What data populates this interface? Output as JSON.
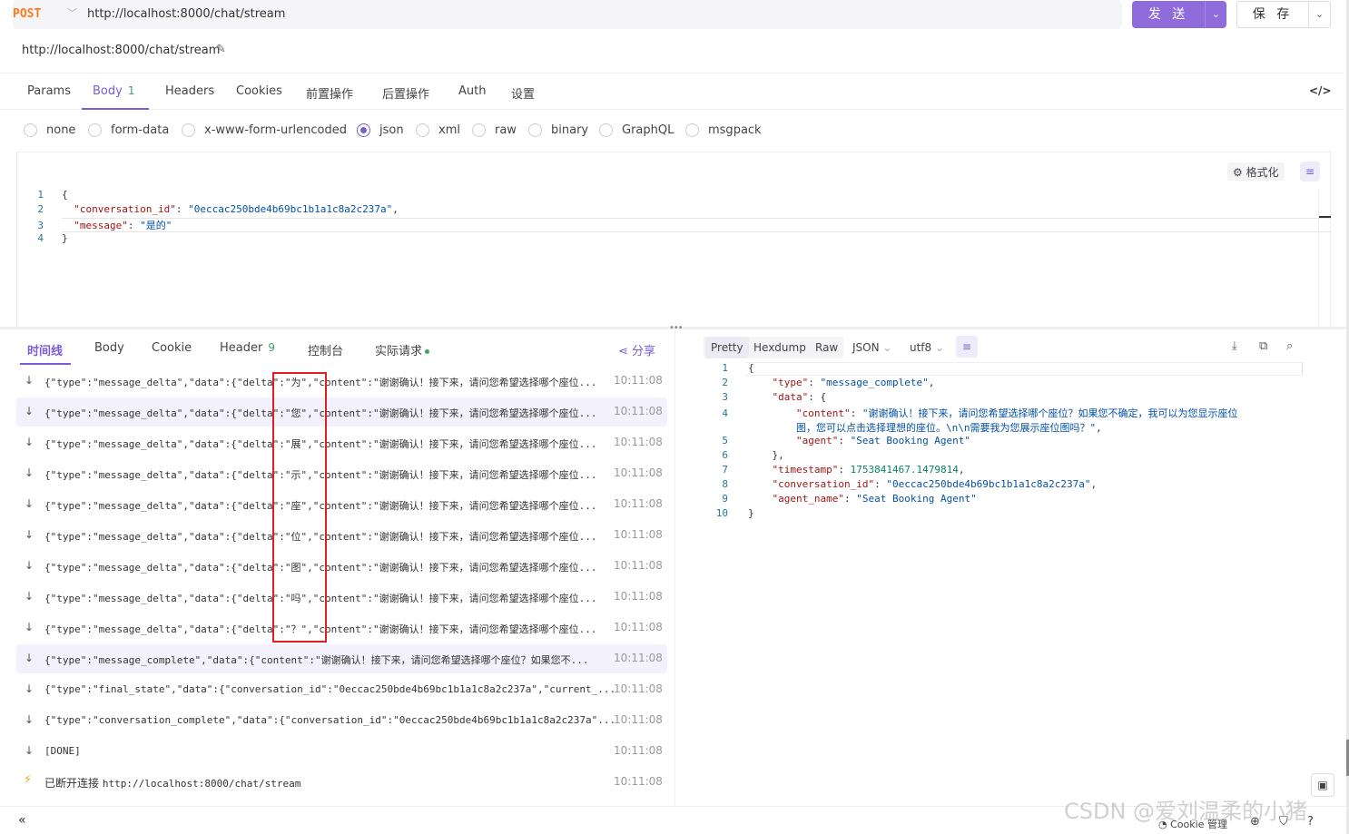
{
  "request": {
    "method": "POST",
    "url": "http://localhost:8000/chat/stream",
    "name": "http://localhost:8000/chat/stream",
    "send_label": "发 送",
    "save_label": "保 存"
  },
  "req_tabs": [
    {
      "label": "Params"
    },
    {
      "label": "Body",
      "count": "1"
    },
    {
      "label": "Headers"
    },
    {
      "label": "Cookies"
    },
    {
      "label": "前置操作"
    },
    {
      "label": "后置操作"
    },
    {
      "label": "Auth"
    },
    {
      "label": "设置"
    }
  ],
  "body_types": [
    "none",
    "form-data",
    "x-www-form-urlencoded",
    "json",
    "xml",
    "raw",
    "binary",
    "GraphQL",
    "msgpack"
  ],
  "body_type_selected": "json",
  "editor": {
    "format_label": "格式化",
    "lines": [
      {
        "n": "1",
        "text": "{"
      },
      {
        "n": "2",
        "key": "\"conversation_id\"",
        "value": "\"0eccac250bde4b69bc1b1a1c8a2c237a\"",
        "tail": ","
      },
      {
        "n": "3",
        "key": "\"message\"",
        "value": "\"是的\"",
        "tail": ""
      },
      {
        "n": "4",
        "text": "}"
      }
    ]
  },
  "resp_tabs": [
    {
      "label": "时间线"
    },
    {
      "label": "Body"
    },
    {
      "label": "Cookie"
    },
    {
      "label": "Header",
      "count": "9"
    },
    {
      "label": "控制台"
    },
    {
      "label": "实际请求"
    }
  ],
  "share_label": "分享",
  "timeline": [
    {
      "text": "{\"type\":\"message_delta\",\"data\":{\"delta\":\"为\",\"content\":\"谢谢确认！接下来，请问您希望选择哪个座位...",
      "time": "10:11:08"
    },
    {
      "text": "{\"type\":\"message_delta\",\"data\":{\"delta\":\"您\",\"content\":\"谢谢确认！接下来，请问您希望选择哪个座位...",
      "time": "10:11:08"
    },
    {
      "text": "{\"type\":\"message_delta\",\"data\":{\"delta\":\"展\",\"content\":\"谢谢确认！接下来，请问您希望选择哪个座位...",
      "time": "10:11:08"
    },
    {
      "text": "{\"type\":\"message_delta\",\"data\":{\"delta\":\"示\",\"content\":\"谢谢确认！接下来，请问您希望选择哪个座位...",
      "time": "10:11:08"
    },
    {
      "text": "{\"type\":\"message_delta\",\"data\":{\"delta\":\"座\",\"content\":\"谢谢确认！接下来，请问您希望选择哪个座位...",
      "time": "10:11:08"
    },
    {
      "text": "{\"type\":\"message_delta\",\"data\":{\"delta\":\"位\",\"content\":\"谢谢确认！接下来，请问您希望选择哪个座位...",
      "time": "10:11:08"
    },
    {
      "text": "{\"type\":\"message_delta\",\"data\":{\"delta\":\"图\",\"content\":\"谢谢确认！接下来，请问您希望选择哪个座位...",
      "time": "10:11:08"
    },
    {
      "text": "{\"type\":\"message_delta\",\"data\":{\"delta\":\"吗\",\"content\":\"谢谢确认！接下来，请问您希望选择哪个座位...",
      "time": "10:11:08"
    },
    {
      "text": "{\"type\":\"message_delta\",\"data\":{\"delta\":\"？\",\"content\":\"谢谢确认！接下来，请问您希望选择哪个座位...",
      "time": "10:11:08"
    },
    {
      "text": "{\"type\":\"message_complete\",\"data\":{\"content\":\"谢谢确认！接下来，请问您希望选择哪个座位？如果您不...",
      "time": "10:11:08"
    },
    {
      "text": "{\"type\":\"final_state\",\"data\":{\"conversation_id\":\"0eccac250bde4b69bc1b1a1c8a2c237a\",\"current_...",
      "time": "10:11:08"
    },
    {
      "text": "{\"type\":\"conversation_complete\",\"data\":{\"conversation_id\":\"0eccac250bde4b69bc1b1a1c8a2c237a\"...",
      "time": "10:11:08"
    },
    {
      "text": "[DONE]",
      "time": "10:11:08"
    }
  ],
  "disconnect": {
    "label": "已断开连接",
    "url": "http://localhost:8000/chat/stream",
    "time": "10:11:08"
  },
  "resp_toolbar": {
    "views": [
      "Pretty",
      "Hexdump",
      "Raw"
    ],
    "format": "JSON",
    "encoding": "utf8"
  },
  "response_lines": [
    {
      "n": "1",
      "parts": [
        [
          "p",
          "{"
        ]
      ]
    },
    {
      "n": "2",
      "parts": [
        [
          "p",
          "    "
        ],
        [
          "k",
          "\"type\""
        ],
        [
          "p",
          ": "
        ],
        [
          "s",
          "\"message_complete\""
        ],
        [
          "p",
          ","
        ]
      ]
    },
    {
      "n": "3",
      "parts": [
        [
          "p",
          "    "
        ],
        [
          "k",
          "\"data\""
        ],
        [
          "p",
          ": {"
        ]
      ]
    },
    {
      "n": "4",
      "parts": [
        [
          "p",
          "        "
        ],
        [
          "k",
          "\"content\""
        ],
        [
          "p",
          ": "
        ],
        [
          "s",
          "\"谢谢确认！接下来，请问您希望选择哪个座位？如果您不确定，我可以为您显示座位"
        ]
      ]
    },
    {
      "n": "",
      "parts": [
        [
          "p",
          "        "
        ],
        [
          "s",
          "图，您可以点击选择理想的座位。\\n\\n需要我为您展示座位图吗？\""
        ],
        [
          "p",
          ","
        ]
      ]
    },
    {
      "n": "5",
      "parts": [
        [
          "p",
          "        "
        ],
        [
          "k",
          "\"agent\""
        ],
        [
          "p",
          ": "
        ],
        [
          "s",
          "\"Seat Booking Agent\""
        ]
      ]
    },
    {
      "n": "6",
      "parts": [
        [
          "p",
          "    },"
        ]
      ]
    },
    {
      "n": "7",
      "parts": [
        [
          "p",
          "    "
        ],
        [
          "k",
          "\"timestamp\""
        ],
        [
          "p",
          ": "
        ],
        [
          "n",
          "1753841467.1479814"
        ],
        [
          "p",
          ","
        ]
      ]
    },
    {
      "n": "8",
      "parts": [
        [
          "p",
          "    "
        ],
        [
          "k",
          "\"conversation_id\""
        ],
        [
          "p",
          ": "
        ],
        [
          "s",
          "\"0eccac250bde4b69bc1b1a1c8a2c237a\""
        ],
        [
          "p",
          ","
        ]
      ]
    },
    {
      "n": "9",
      "parts": [
        [
          "p",
          "    "
        ],
        [
          "k",
          "\"agent_name\""
        ],
        [
          "p",
          ": "
        ],
        [
          "s",
          "\"Seat Booking Agent\""
        ]
      ]
    },
    {
      "n": "10",
      "parts": [
        [
          "p",
          "}"
        ]
      ]
    }
  ],
  "footer": {
    "cookie_label": "Cookie 管理"
  },
  "watermark": "CSDN @爱刘温柔的小猪",
  "colors": {
    "accent": "#7b5cd6",
    "send_button": "#8f6bdc",
    "method": "#ff7a1a",
    "highlight_box": "#e02020"
  }
}
